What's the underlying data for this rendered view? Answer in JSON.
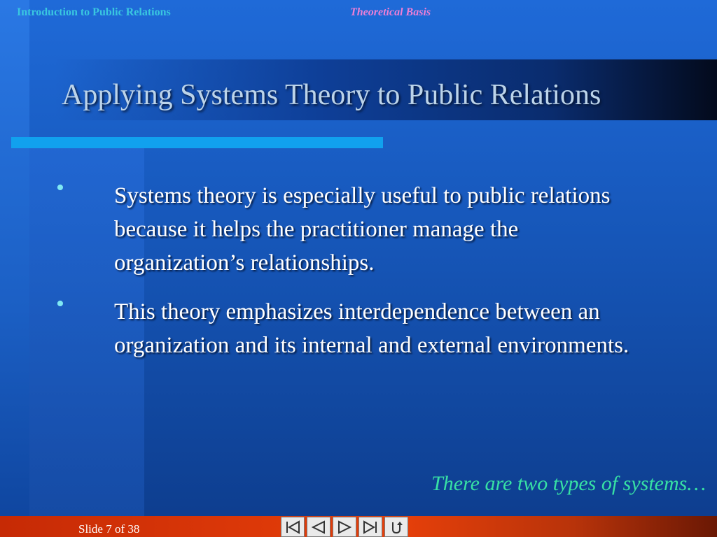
{
  "header": {
    "course": "Introduction to Public Relations",
    "section": "Theoretical Basis"
  },
  "slide": {
    "title": "Applying Systems Theory to Public Relations",
    "bullets": [
      {
        "symbol": "•",
        "text": "Systems theory is especially useful to public relations because it helps the practitioner manage the organization’s relationships."
      },
      {
        "symbol": "•",
        "text": "This theory emphasizes interdependence between an organization and its internal and external environments."
      }
    ],
    "next_hint": "There are two types of systems…"
  },
  "footer": {
    "slide_counter": "Slide 7 of   38"
  },
  "nav": {
    "icons": [
      "first-slide-icon",
      "previous-slide-icon",
      "next-slide-icon",
      "last-slide-icon",
      "return-icon"
    ]
  },
  "colors": {
    "course_text": "#39c7e0",
    "section_text": "#ee7fd6",
    "bullet": "#7fe8f3",
    "hint_text": "#37e0a4",
    "accent_bar": "#11a1ee",
    "bottom_bar": "#e8400a"
  }
}
